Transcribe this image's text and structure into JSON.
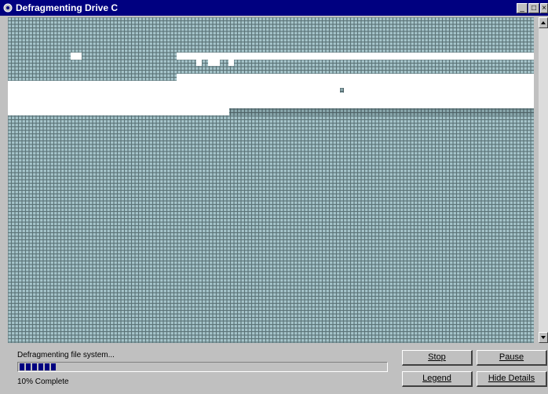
{
  "window": {
    "title": "Defragmenting Drive C"
  },
  "controls": {
    "minimize": "_",
    "maximize": "□",
    "close": "×"
  },
  "status": {
    "message": "Defragmenting file system...",
    "percent_text": "10% Complete",
    "progress": 0.1
  },
  "buttons": {
    "stop": "Stop",
    "pause": "Pause",
    "legend": "Legend",
    "hide_details": "Hide Details"
  },
  "colors": {
    "titlebar": "#000080",
    "used_block": "#97b7bd",
    "optimized_block": "#6f8f95",
    "free_space": "#ffffff",
    "progress": "#000080"
  },
  "icons": {
    "title": "defrag-icon"
  }
}
